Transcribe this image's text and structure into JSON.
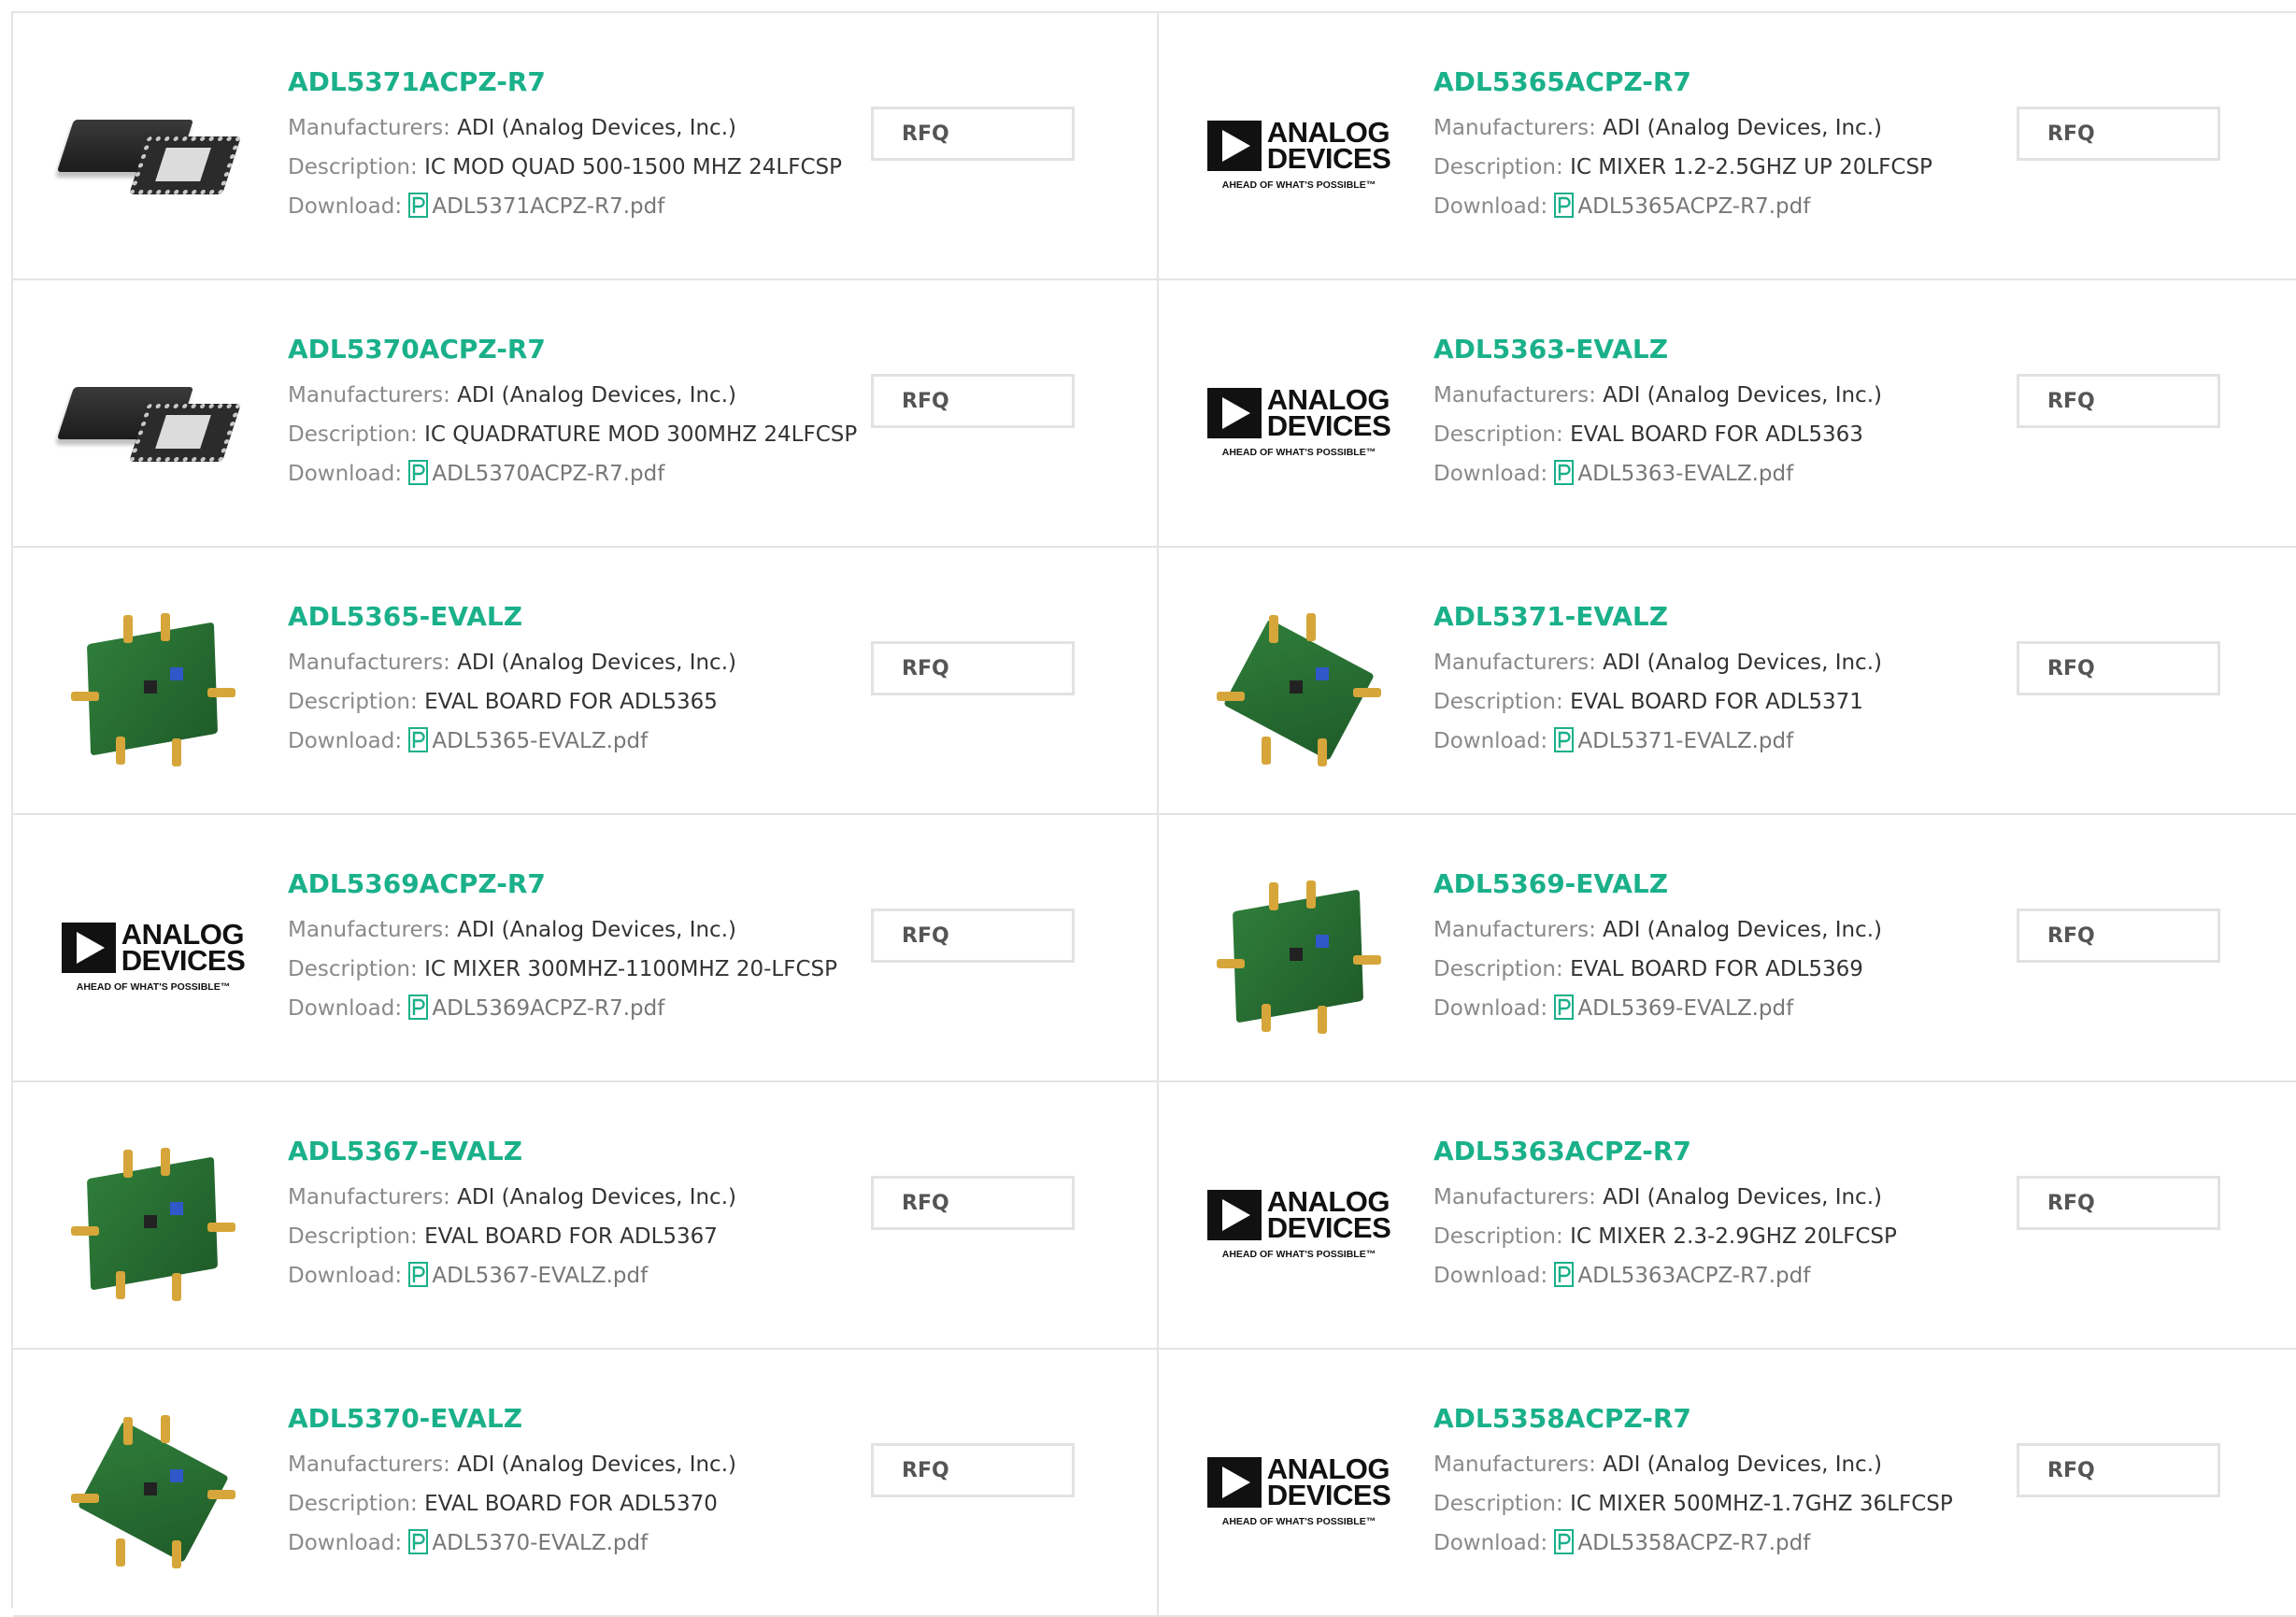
{
  "labels": {
    "manufacturers": "Manufacturers:",
    "description": "Description:",
    "download": "Download:",
    "rfq": "RFQ"
  },
  "logo": {
    "line1": "ANALOG",
    "line2": "DEVICES",
    "tagline": "AHEAD OF WHAT'S POSSIBLE™"
  },
  "colors": {
    "part_link": "#1ab08a",
    "pdf_icon": "#1ab08a",
    "label": "#8a8a8a",
    "border": "#e4e4e4"
  },
  "products": [
    {
      "part": "ADL5371ACPZ-R7",
      "manufacturer": "ADI (Analog Devices, Inc.)",
      "description": "IC MOD QUAD 500-1500 MHZ 24LFCSP",
      "pdf": "ADL5371ACPZ-R7.pdf",
      "image": "chip"
    },
    {
      "part": "ADL5365ACPZ-R7",
      "manufacturer": "ADI (Analog Devices, Inc.)",
      "description": "IC MIXER 1.2-2.5GHZ UP 20LFCSP",
      "pdf": "ADL5365ACPZ-R7.pdf",
      "image": "logo"
    },
    {
      "part": "ADL5370ACPZ-R7",
      "manufacturer": "ADI (Analog Devices, Inc.)",
      "description": "IC QUADRATURE MOD 300MHZ 24LFCSP",
      "pdf": "ADL5370ACPZ-R7.pdf",
      "image": "chip"
    },
    {
      "part": "ADL5363-EVALZ",
      "manufacturer": "ADI (Analog Devices, Inc.)",
      "description": "EVAL BOARD FOR ADL5363",
      "pdf": "ADL5363-EVALZ.pdf",
      "image": "logo"
    },
    {
      "part": "ADL5365-EVALZ",
      "manufacturer": "ADI (Analog Devices, Inc.)",
      "description": "EVAL BOARD FOR ADL5365",
      "pdf": "ADL5365-EVALZ.pdf",
      "image": "board"
    },
    {
      "part": "ADL5371-EVALZ",
      "manufacturer": "ADI (Analog Devices, Inc.)",
      "description": "EVAL BOARD FOR ADL5371",
      "pdf": "ADL5371-EVALZ.pdf",
      "image": "board-alt"
    },
    {
      "part": "ADL5369ACPZ-R7",
      "manufacturer": "ADI (Analog Devices, Inc.)",
      "description": "IC MIXER 300MHZ-1100MHZ 20-LFCSP",
      "pdf": "ADL5369ACPZ-R7.pdf",
      "image": "logo"
    },
    {
      "part": "ADL5369-EVALZ",
      "manufacturer": "ADI (Analog Devices, Inc.)",
      "description": "EVAL BOARD FOR ADL5369",
      "pdf": "ADL5369-EVALZ.pdf",
      "image": "board"
    },
    {
      "part": "ADL5367-EVALZ",
      "manufacturer": "ADI (Analog Devices, Inc.)",
      "description": "EVAL BOARD FOR ADL5367",
      "pdf": "ADL5367-EVALZ.pdf",
      "image": "board"
    },
    {
      "part": "ADL5363ACPZ-R7",
      "manufacturer": "ADI (Analog Devices, Inc.)",
      "description": "IC MIXER 2.3-2.9GHZ 20LFCSP",
      "pdf": "ADL5363ACPZ-R7.pdf",
      "image": "logo"
    },
    {
      "part": "ADL5370-EVALZ",
      "manufacturer": "ADI (Analog Devices, Inc.)",
      "description": "EVAL BOARD FOR ADL5370",
      "pdf": "ADL5370-EVALZ.pdf",
      "image": "board-alt"
    },
    {
      "part": "ADL5358ACPZ-R7",
      "manufacturer": "ADI (Analog Devices, Inc.)",
      "description": "IC MIXER 500MHZ-1.7GHZ 36LFCSP",
      "pdf": "ADL5358ACPZ-R7.pdf",
      "image": "logo"
    }
  ]
}
